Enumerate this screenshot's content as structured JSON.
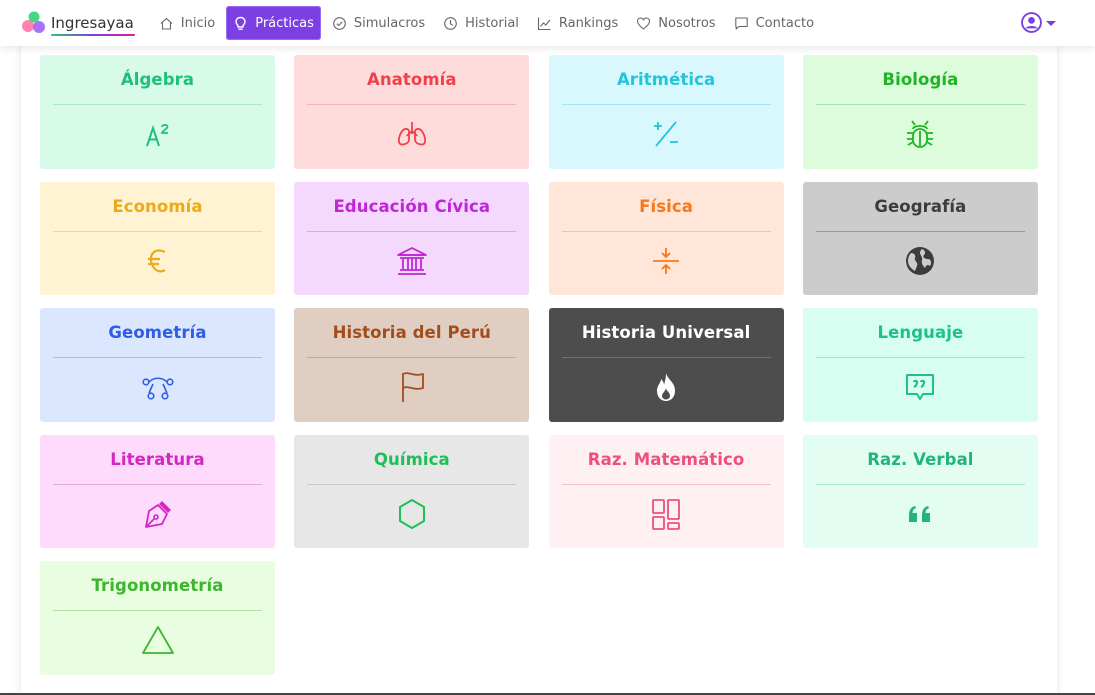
{
  "brand": {
    "name": "Ingresayaa"
  },
  "nav": {
    "items": [
      {
        "label": "Inicio",
        "icon": "home-icon",
        "active": false
      },
      {
        "label": "Prácticas",
        "icon": "lightbulb-icon",
        "active": true
      },
      {
        "label": "Simulacros",
        "icon": "check-circle-icon",
        "active": false
      },
      {
        "label": "Historial",
        "icon": "clock-icon",
        "active": false
      },
      {
        "label": "Rankings",
        "icon": "chart-line-icon",
        "active": false
      },
      {
        "label": "Nosotros",
        "icon": "heart-icon",
        "active": false
      },
      {
        "label": "Contacto",
        "icon": "chat-icon",
        "active": false
      }
    ],
    "user_icon": "user-circle-icon"
  },
  "subjects": [
    {
      "label": "Álgebra",
      "icon": "superscript-icon",
      "color": "#1ec07a",
      "bg": "#d8fbe9",
      "sep": "#a9e8c6"
    },
    {
      "label": "Anatomía",
      "icon": "lungs-icon",
      "color": "#f0414b",
      "bg": "#ffdcdc",
      "sep": "#f5b5b7"
    },
    {
      "label": "Aritmética",
      "icon": "plus-minus-icon",
      "color": "#22c5d9",
      "bg": "#d8f8fd",
      "sep": "#a3e4ee"
    },
    {
      "label": "Biología",
      "icon": "bug-icon",
      "color": "#1fb424",
      "bg": "#dcfcdb",
      "sep": "#a9dfaa"
    },
    {
      "label": "Economía",
      "icon": "euro-icon",
      "color": "#ecaa18",
      "bg": "#fff3d3",
      "sep": "#ecd99f"
    },
    {
      "label": "Educación Cívica",
      "icon": "building-columns-icon",
      "color": "#c126d6",
      "bg": "#f5d8fe",
      "sep": "#dda6ea"
    },
    {
      "label": "Física",
      "icon": "compress-arrows-icon",
      "color": "#f7781a",
      "bg": "#ffe6d9",
      "sep": "#f1c3a4"
    },
    {
      "label": "Geografía",
      "icon": "globe-icon",
      "color": "#3c3c3c",
      "bg": "#cccccc",
      "sep": "#999999"
    },
    {
      "label": "Geometría",
      "icon": "bezier-curve-icon",
      "color": "#2e5de6",
      "bg": "#dbe6ff",
      "sep": "#a9bdf3"
    },
    {
      "label": "Historia del Perú",
      "icon": "flag-icon",
      "color": "#a24e1c",
      "bg": "#e0cec3",
      "sep": "#c7a894"
    },
    {
      "label": "Historia Universal",
      "icon": "fire-icon",
      "color": "#ffffff",
      "bg": "#4d4d4d",
      "sep": "#727272"
    },
    {
      "label": "Lenguaje",
      "icon": "quote-bubble-icon",
      "color": "#1ec189",
      "bg": "#d8fdf1",
      "sep": "#a1e6cd"
    },
    {
      "label": "Literatura",
      "icon": "pen-nib-icon",
      "color": "#d426c3",
      "bg": "#fedbfd",
      "sep": "#e7a9e3"
    },
    {
      "label": "Química",
      "icon": "hexagon-icon",
      "color": "#1dbf57",
      "bg": "#e7e7e7",
      "sep": "#c8c8c8"
    },
    {
      "label": "Raz. Matemático",
      "icon": "layout-grid-icon",
      "color": "#ee4f7c",
      "bg": "#fff0f3",
      "sep": "#f3c2cf"
    },
    {
      "label": "Raz. Verbal",
      "icon": "quote-left-icon",
      "color": "#22b57b",
      "bg": "#e3fdf3",
      "sep": "#ace6cd"
    },
    {
      "label": "Trigonometría",
      "icon": "triangle-icon",
      "color": "#3db62e",
      "bg": "#e9fde1",
      "sep": "#b4e2a6"
    }
  ]
}
